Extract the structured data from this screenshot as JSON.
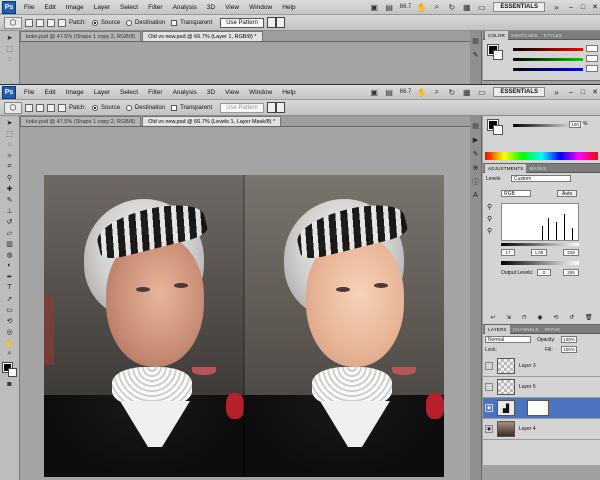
{
  "app": {
    "logo": "Ps",
    "workspace": "ESSENTIALS",
    "zoom": "66.7"
  },
  "menu": [
    "File",
    "Edit",
    "Image",
    "Layer",
    "Select",
    "Filter",
    "Analysis",
    "3D",
    "View",
    "Window",
    "Help"
  ],
  "options": {
    "patch_label": "Patch:",
    "source": "Source",
    "destination": "Destination",
    "transparent": "Transparent",
    "use_pattern": "Use Pattern"
  },
  "top_window": {
    "tabs": [
      "koko.psd @ 47.5% (Shape 1 copy 2, RGB/8)",
      "Old vs new.psd @ 66.7% (Layer 1, RGB/8) *"
    ],
    "color_panel": {
      "tabs": [
        "COLOR",
        "SWATCHES",
        "STYLES"
      ],
      "r": "",
      "g": "",
      "b": ""
    }
  },
  "bottom_window": {
    "tabs": [
      "koko.psd @ 47.5% (Shape 1 copy 2, RGB/8)",
      "Old vs new.psd @ 66.7% (Levels 1, Layer Mask/8) *"
    ],
    "color_panel": {
      "value": "100",
      "unit": "%"
    },
    "adjustments": {
      "tabs": [
        "ADJUSTMENTS",
        "MASKS"
      ],
      "title": "Levels",
      "preset": "Custom",
      "channel": "RGB",
      "auto": "Auto",
      "input_black": "17",
      "input_gamma": "1.05",
      "input_white": "229",
      "output_label": "Output Levels:",
      "output_black": "0",
      "output_white": "255"
    },
    "layers": {
      "tabs": [
        "LAYERS",
        "CHANNELS",
        "PATHS"
      ],
      "blend": "Normal",
      "opacity_label": "Opacity:",
      "opacity": "100%",
      "lock_label": "Lock:",
      "fill_label": "Fill:",
      "fill": "100%",
      "rows": [
        {
          "name": "Layer 3",
          "selected": false
        },
        {
          "name": "Layer 5",
          "selected": false
        },
        {
          "name": "",
          "selected": true
        },
        {
          "name": "Layer 4",
          "selected": false
        }
      ]
    }
  }
}
